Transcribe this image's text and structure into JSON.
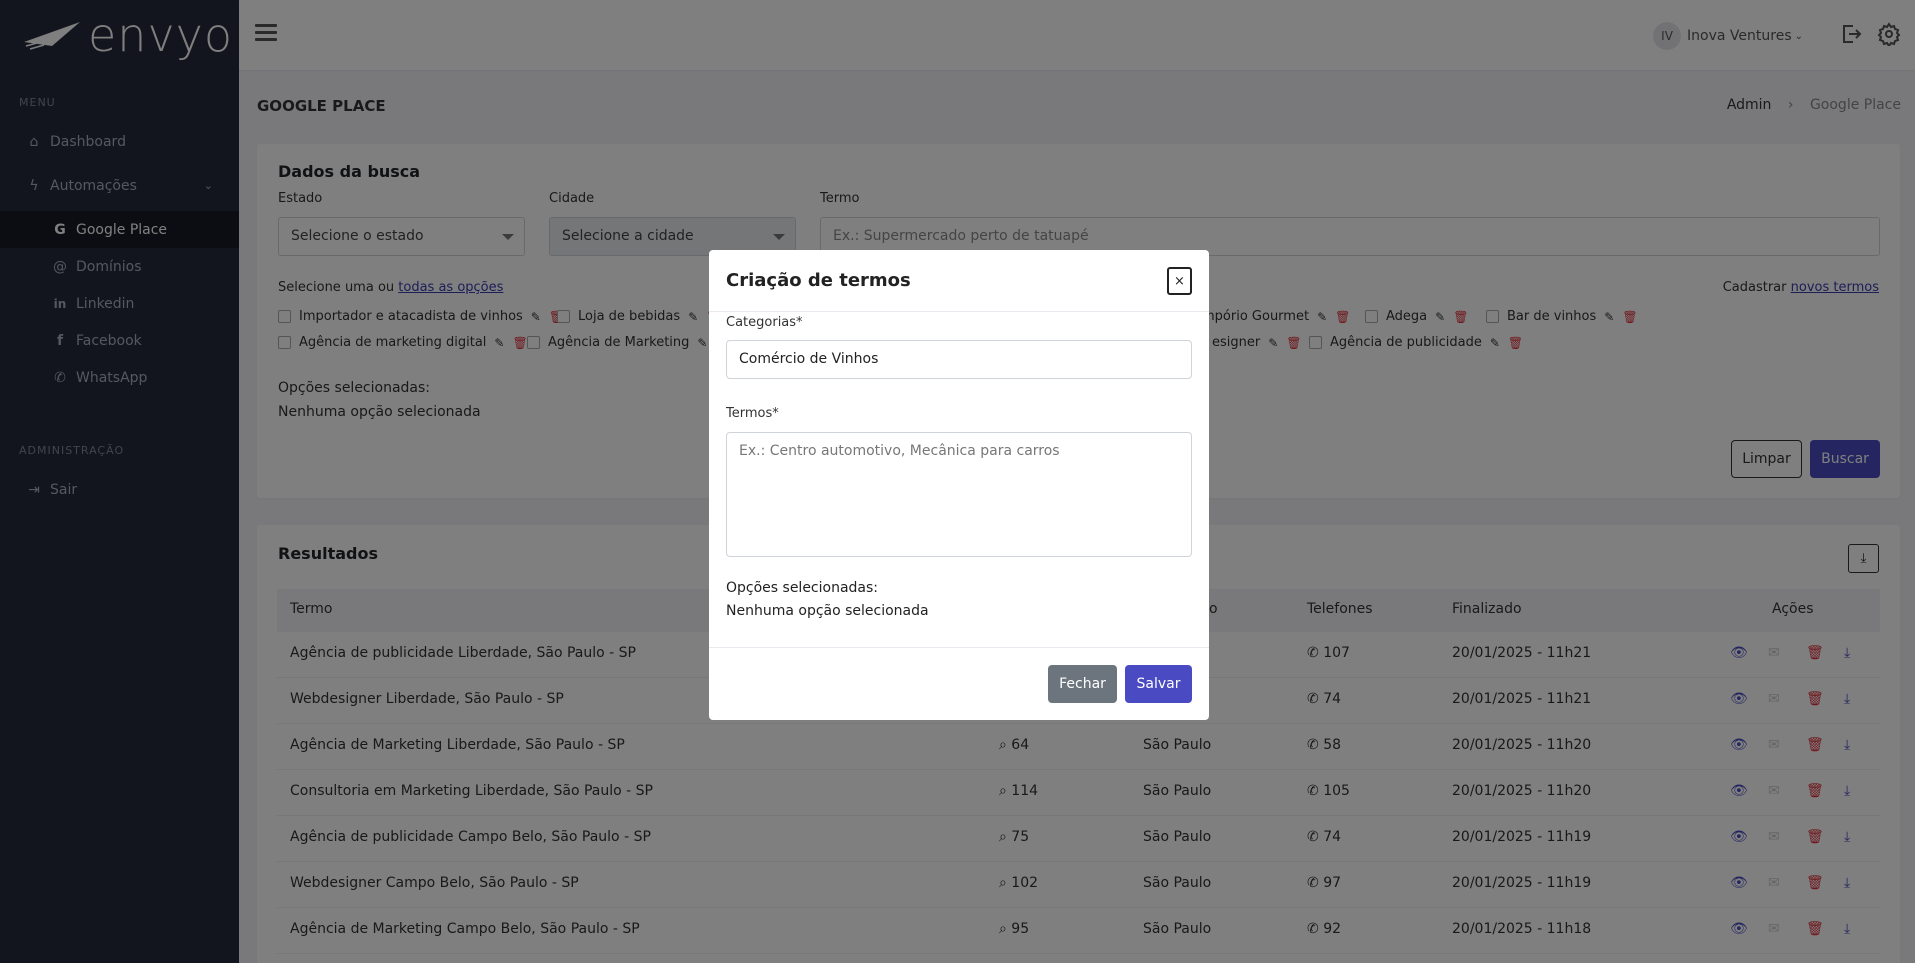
{
  "brand": {
    "name": "envyo"
  },
  "sidebar": {
    "menu_title": "MENU",
    "admin_title": "ADMINISTRAÇÃO",
    "items": [
      {
        "label": "Dashboard",
        "icon": "home-icon"
      },
      {
        "label": "Automações",
        "icon": "bolt-icon"
      },
      {
        "label": "Google Place",
        "icon": "google-icon"
      },
      {
        "label": "Domínios",
        "icon": "at-icon"
      },
      {
        "label": "Linkedin",
        "icon": "linkedin-icon"
      },
      {
        "label": "Facebook",
        "icon": "facebook-icon"
      },
      {
        "label": "WhatsApp",
        "icon": "whatsapp-icon"
      }
    ],
    "logout": "Sair"
  },
  "topbar": {
    "avatar_initials": "IV",
    "user_name": "Inova Ventures"
  },
  "page": {
    "title": "GOOGLE PLACE",
    "breadcrumb": [
      "Admin",
      "Google Place"
    ]
  },
  "search": {
    "title": "Dados da busca",
    "estado_label": "Estado",
    "estado_value": "Selecione o estado",
    "cidade_label": "Cidade",
    "cidade_value": "Selecione a cidade",
    "termo_label": "Termo",
    "termo_placeholder": "Ex.: Supermercado perto de tatuapé",
    "select_prefix": "Selecione uma ou",
    "select_all": "todas as opções",
    "register_prefix": "Cadastrar",
    "register_link": "novos termos",
    "options_row1": [
      "Importador e atacadista de vinhos",
      "Loja de bebidas",
      "mpório Gourmet",
      "Adega",
      "Bar de vinhos"
    ],
    "options_row2": [
      "Agência de marketing digital",
      "Agência de Marketing",
      "esigner",
      "Agência de publicidade"
    ],
    "selected_title": "Opções selecionadas:",
    "selected_none": "Nenhuma opção selecionada",
    "clear_label": "Limpar",
    "search_label": "Buscar"
  },
  "results": {
    "title": "Resultados",
    "columns": [
      "Termo",
      "o",
      "Telefones",
      "Finalizado",
      "Ações"
    ],
    "rows": [
      {
        "termo": "Agência de publicidade Liberdade, São Paulo - SP",
        "buscas": "",
        "cidade": "",
        "telefones": "107",
        "finalizado": "20/01/2025 - 11h21"
      },
      {
        "termo": "Webdesigner Liberdade, São Paulo - SP",
        "buscas": "",
        "cidade": "",
        "telefones": "74",
        "finalizado": "20/01/2025 - 11h21"
      },
      {
        "termo": "Agência de Marketing Liberdade, São Paulo - SP",
        "buscas": "64",
        "cidade": "São Paulo",
        "telefones": "58",
        "finalizado": "20/01/2025 - 11h20"
      },
      {
        "termo": "Consultoria em Marketing Liberdade, São Paulo - SP",
        "buscas": "114",
        "cidade": "São Paulo",
        "telefones": "105",
        "finalizado": "20/01/2025 - 11h20"
      },
      {
        "termo": "Agência de publicidade Campo Belo, São Paulo - SP",
        "buscas": "75",
        "cidade": "São Paulo",
        "telefones": "74",
        "finalizado": "20/01/2025 - 11h19"
      },
      {
        "termo": "Webdesigner Campo Belo, São Paulo - SP",
        "buscas": "102",
        "cidade": "São Paulo",
        "telefones": "97",
        "finalizado": "20/01/2025 - 11h19"
      },
      {
        "termo": "Agência de Marketing Campo Belo, São Paulo - SP",
        "buscas": "95",
        "cidade": "São Paulo",
        "telefones": "92",
        "finalizado": "20/01/2025 - 11h18"
      }
    ]
  },
  "modal": {
    "title": "Criação de termos",
    "close": "×",
    "categorias_label": "Categorias*",
    "categorias_value": "Comércio de Vinhos",
    "termos_label": "Termos*",
    "termos_placeholder": "Ex.: Centro automotivo, Mecânica para carros",
    "selected_title": "Opções selecionadas:",
    "selected_none": "Nenhuma opção selecionada",
    "close_label": "Fechar",
    "save_label": "Salvar"
  },
  "colors": {
    "sidebar_bg": "#262b3c",
    "primary": "#4a4ac2",
    "danger": "#e0303a",
    "eye": "#4a4ac2"
  }
}
